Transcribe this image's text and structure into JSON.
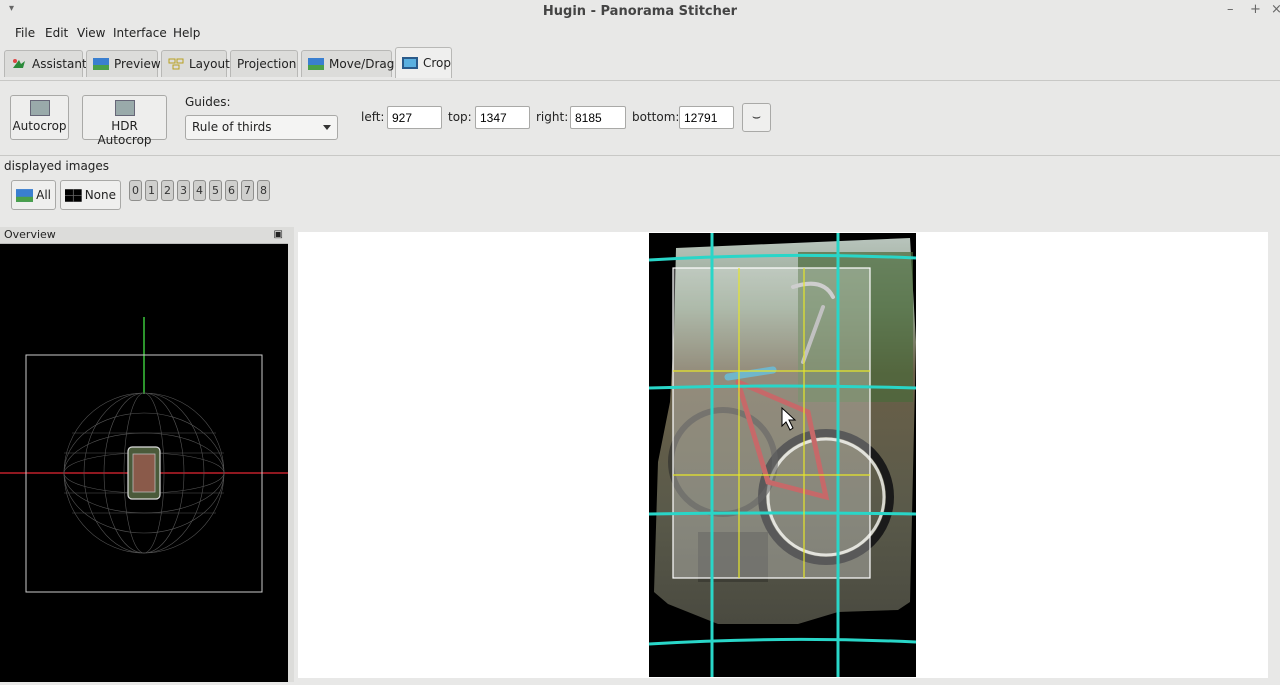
{
  "window": {
    "title": "Hugin - Panorama Stitcher",
    "menu_glyph": "▾",
    "minimize": "–",
    "maximize": "+",
    "close": "×"
  },
  "menu": {
    "items": [
      "File",
      "Edit",
      "View",
      "Interface",
      "Help"
    ]
  },
  "tabs": [
    {
      "label": "Assistant",
      "icon": "assistant-icon"
    },
    {
      "label": "Preview",
      "icon": "preview-icon"
    },
    {
      "label": "Layout",
      "icon": "layout-icon"
    },
    {
      "label": "Projection"
    },
    {
      "label": "Move/Drag",
      "icon": "move-drag-icon"
    },
    {
      "label": "Crop",
      "icon": "crop-icon",
      "active": true
    }
  ],
  "toolbar": {
    "autocrop_label": "Autocrop",
    "hdr_autocrop_label": "HDR Autocrop",
    "guides_label": "Guides:",
    "guides_value": "Rule of thirds",
    "left_label": "left:",
    "left_value": "927",
    "top_label": "top:",
    "top_value": "1347",
    "right_label": "right:",
    "right_value": "8185",
    "bottom_label": "bottom:",
    "bottom_value": "12791",
    "reset_glyph": "⌣"
  },
  "displayed": {
    "label": "displayed images",
    "all_label": "All",
    "none_label": "None",
    "images": [
      "0",
      "1",
      "2",
      "3",
      "4",
      "5",
      "6",
      "7",
      "8"
    ]
  },
  "overview": {
    "title": "Overview",
    "pin_glyph": "▣"
  },
  "colors": {
    "guide_yellow": "#e6e62a",
    "grid_cyan": "#29d6c8",
    "crop_border": "#ffffff",
    "axis_red": "#c0202a",
    "axis_green": "#3ac63a"
  }
}
